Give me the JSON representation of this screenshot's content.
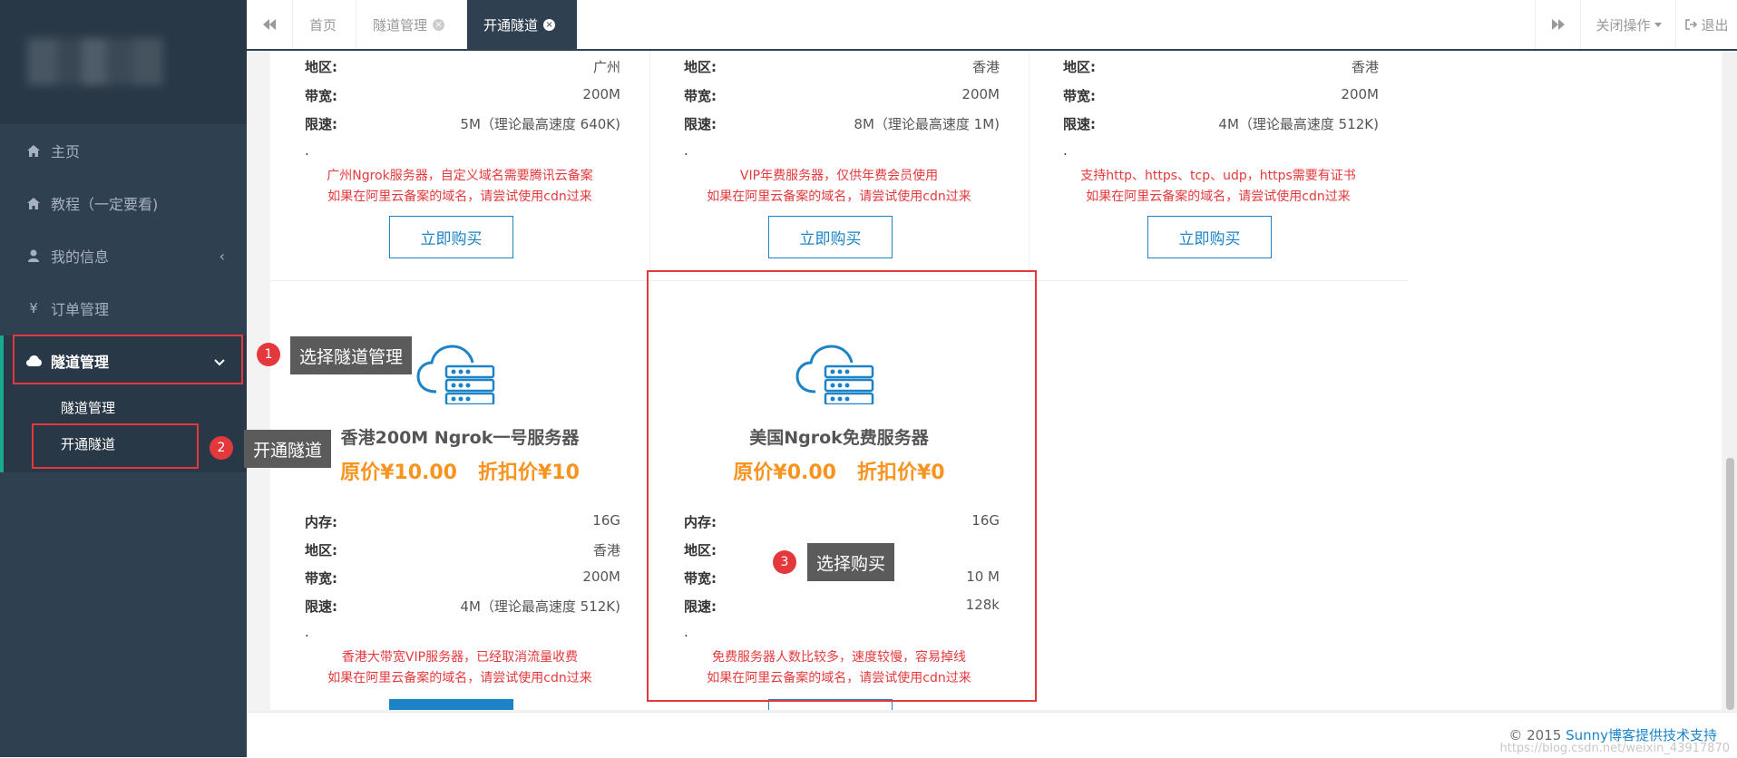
{
  "sidebar": {
    "items": [
      {
        "label": "主页",
        "icon": "home-icon"
      },
      {
        "label": "教程（一定要看)",
        "icon": "home-icon"
      },
      {
        "label": "我的信息",
        "icon": "user-icon",
        "chevron": "‹"
      },
      {
        "label": "订单管理",
        "icon": "yen-icon"
      },
      {
        "label": "隧道管理",
        "icon": "cloud-icon",
        "chevron": "⌄"
      }
    ],
    "submenu": [
      "隧道管理",
      "开通隧道"
    ]
  },
  "tabs": {
    "items": [
      {
        "label": "首页"
      },
      {
        "label": "隧道管理"
      },
      {
        "label": "开通隧道"
      }
    ],
    "close_glyph": "×",
    "actions_label": "关闭操作",
    "logout_label": "退出"
  },
  "labels": {
    "memory": "内存:",
    "region": "地区:",
    "bandwidth": "带宽:",
    "speed": "限速:",
    "dot": ".",
    "buy": "立即购买"
  },
  "top_cards": [
    {
      "region": "广州",
      "bandwidth": "200M",
      "speed": "5M（理论最高速度 640K)",
      "desc1": "广州Ngrok服务器，自定义域名需要腾讯云备案",
      "desc2": "如果在阿里云备案的域名，请尝试使用cdn过来"
    },
    {
      "region": "香港",
      "bandwidth": "200M",
      "speed": "8M（理论最高速度 1M)",
      "desc1": "VIP年费服务器，仅供年费会员使用",
      "desc2": "如果在阿里云备案的域名，请尝试使用cdn过来"
    },
    {
      "region": "香港",
      "bandwidth": "200M",
      "speed": "4M（理论最高速度 512K)",
      "desc1": "支持http、https、tcp、udp，https需要有证书",
      "desc2": "如果在阿里云备案的域名，请尝试使用cdn过来"
    }
  ],
  "bottom_cards": [
    {
      "title": "香港200M Ngrok一号服务器",
      "original_price": "原价¥10.00",
      "discount_price": "折扣价¥10",
      "memory": "16G",
      "region": "香港",
      "bandwidth": "200M",
      "speed": "4M（理论最高速度 512K)",
      "desc1": "香港大带宽VIP服务器，已经取消流量收费",
      "desc2": "如果在阿里云备案的域名，请尝试使用cdn过来"
    },
    {
      "title": "美国Ngrok免费服务器",
      "original_price": "原价¥0.00",
      "discount_price": "折扣价¥0",
      "memory": "16G",
      "region": "",
      "bandwidth": "10 M",
      "speed": "128k",
      "desc1": "免费服务器人数比较多，速度较慢，容易掉线",
      "desc2": "如果在阿里云备案的域名，请尝试使用cdn过来"
    }
  ],
  "annotations": [
    {
      "number": "1",
      "text": "选择隧道管理"
    },
    {
      "number": "2",
      "text": "开通隧道"
    },
    {
      "number": "3",
      "text": "选择购买"
    }
  ],
  "footer": {
    "copyright": "© 2015 ",
    "link": "Sunny博客提供技术支持",
    "watermark": "https://blog.csdn.net/weixin_43917870"
  },
  "colors": {
    "sidebar_bg": "#2f4050",
    "accent_green": "#19aa8d",
    "primary_blue": "#1c84c6",
    "price_orange": "#f7931e",
    "note_red": "#e4393c"
  }
}
